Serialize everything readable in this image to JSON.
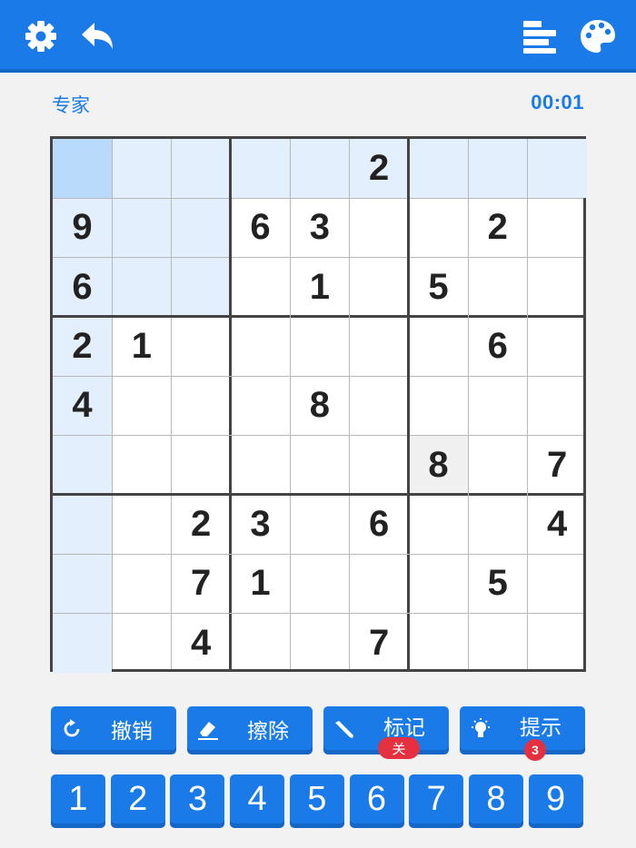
{
  "header": {
    "icons": [
      "gear-icon",
      "undo-arrow-icon",
      "stats-bars-icon",
      "palette-icon"
    ]
  },
  "info": {
    "difficulty": "专家",
    "timer": "00:01"
  },
  "board": {
    "grid": [
      [
        "",
        "",
        "",
        "",
        "",
        "2",
        "",
        "",
        ""
      ],
      [
        "9",
        "",
        "",
        "6",
        "3",
        "",
        "",
        "2",
        ""
      ],
      [
        "6",
        "",
        "",
        "",
        "1",
        "",
        "5",
        "",
        ""
      ],
      [
        "2",
        "1",
        "",
        "",
        "",
        "",
        "",
        "6",
        ""
      ],
      [
        "4",
        "",
        "",
        "",
        "8",
        "",
        "",
        "",
        ""
      ],
      [
        "",
        "",
        "",
        "",
        "",
        "",
        "8",
        "",
        "7"
      ],
      [
        "",
        "",
        "2",
        "3",
        "",
        "6",
        "",
        "",
        "4"
      ],
      [
        "",
        "",
        "7",
        "1",
        "",
        "",
        "",
        "5",
        ""
      ],
      [
        "",
        "",
        "4",
        "",
        "",
        "7",
        "",
        "",
        ""
      ]
    ],
    "selected_cell": [
      0,
      0
    ],
    "highlight_cell": [
      5,
      6
    ]
  },
  "actions": {
    "undo": {
      "label": "撤销",
      "icon": "undo-circle-icon"
    },
    "erase": {
      "label": "擦除",
      "icon": "eraser-icon"
    },
    "notes": {
      "label": "标记",
      "icon": "pencil-icon",
      "status": "关"
    },
    "hint": {
      "label": "提示",
      "icon": "lightbulb-icon",
      "count": "3"
    }
  },
  "numpad": [
    "1",
    "2",
    "3",
    "4",
    "5",
    "6",
    "7",
    "8",
    "9"
  ],
  "colors": {
    "primary": "#1a7be8",
    "primary_dark": "#1466c7",
    "selected": "#b9dafa",
    "related": "#e3effc",
    "badge": "#e53040"
  }
}
